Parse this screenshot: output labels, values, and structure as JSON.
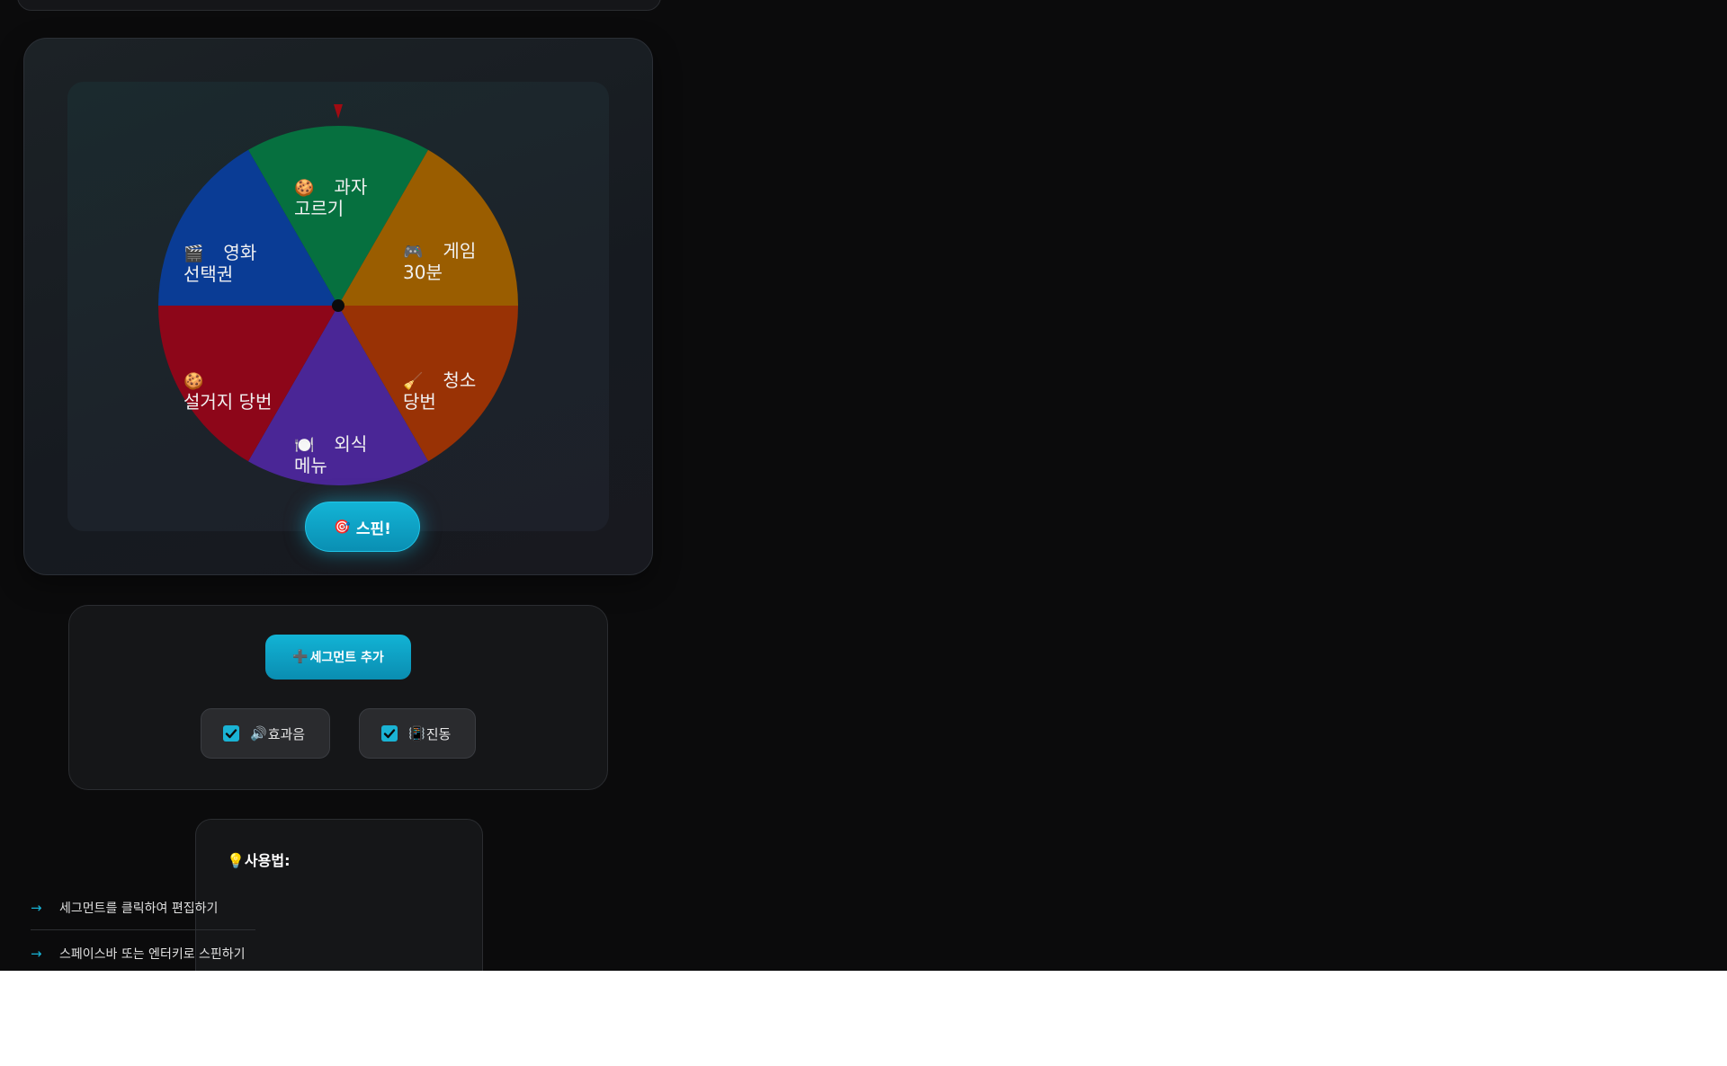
{
  "wheel": {
    "pointer_color": "#a00b12",
    "center_color": "#0b0b0c",
    "segments": [
      {
        "icon": "🍪",
        "icon_name": "cookie-icon",
        "label": "과자\n고르기",
        "color": "#06703f"
      },
      {
        "icon": "🎮",
        "icon_name": "gamepad-icon",
        "label": "게임\n30분",
        "color": "#9a5d00"
      },
      {
        "icon": "🧹",
        "icon_name": "broom-icon",
        "label": "청소\n당번",
        "color": "#993205"
      },
      {
        "icon": "🍽️",
        "icon_name": "plate-utensils-icon",
        "label": "외식\n메뉴",
        "color": "#4a2696"
      },
      {
        "icon": "🍪",
        "icon_name": "cookie-icon",
        "label": "\n설거지 당번",
        "color": "#8d0619"
      },
      {
        "icon": "🎬",
        "icon_name": "clapperboard-icon",
        "label": "영화\n선택권",
        "color": "#0a3c95"
      }
    ],
    "spin_button": {
      "icon": "🎯",
      "label": "스핀!"
    }
  },
  "controls": {
    "add_segment": {
      "icon": "➕",
      "label": "세그먼트 추가"
    },
    "sound": {
      "icon": "🔊",
      "label": "효과음",
      "checked": true
    },
    "vibration": {
      "icon": "📳",
      "label": "진동",
      "checked": true
    }
  },
  "help": {
    "title_icon": "💡",
    "title": "사용법:",
    "items": [
      {
        "arrow": "→",
        "text": "세그먼트를 클릭하여 편집하기"
      },
      {
        "arrow": "→",
        "text": "스페이스바 또는 엔터키로 스핀하기"
      }
    ]
  },
  "accent_color": "#12b3d5"
}
